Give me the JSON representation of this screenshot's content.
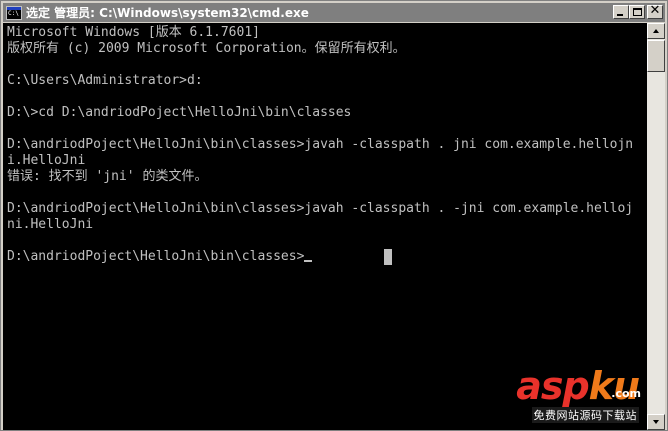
{
  "window": {
    "title": "选定 管理员: C:\\Windows\\system32\\cmd.exe",
    "icon": "cmd-console-icon",
    "caption_buttons": [
      {
        "name": "minimize",
        "icon": "minimize-icon"
      },
      {
        "name": "maximize",
        "icon": "maximize-icon"
      },
      {
        "name": "close",
        "icon": "close-icon",
        "glyph": "✕"
      }
    ]
  },
  "console": {
    "background": "#000000",
    "foreground": "#c0c0c0",
    "lines": [
      "Microsoft Windows [版本 6.1.7601]",
      "版权所有 (c) 2009 Microsoft Corporation。保留所有权利。",
      "",
      "C:\\Users\\Administrator>d:",
      "",
      "D:\\>cd D:\\andriodPoject\\HelloJni\\bin\\classes",
      "",
      "D:\\andriodPoject\\HelloJni\\bin\\classes>javah -classpath . jni com.example.hellojn",
      "i.HelloJni",
      "错误: 找不到 'jni' 的类文件。",
      "",
      "D:\\andriodPoject\\HelloJni\\bin\\classes>javah -classpath . -jni com.example.helloj",
      "ni.HelloJni",
      "",
      "D:\\andriodPoject\\HelloJni\\bin\\classes>"
    ]
  },
  "scrollbar": {
    "up_icon": "scroll-up-arrow-icon",
    "down_icon": "scroll-down-arrow-icon",
    "position_fraction": 0.0
  },
  "watermark": {
    "part1": "asp",
    "part2": "ku",
    "tld": ".com",
    "subtitle": "免费网站源码下载站",
    "colors": {
      "asp": "#e8322b",
      "ku": "#f07a1a"
    }
  }
}
